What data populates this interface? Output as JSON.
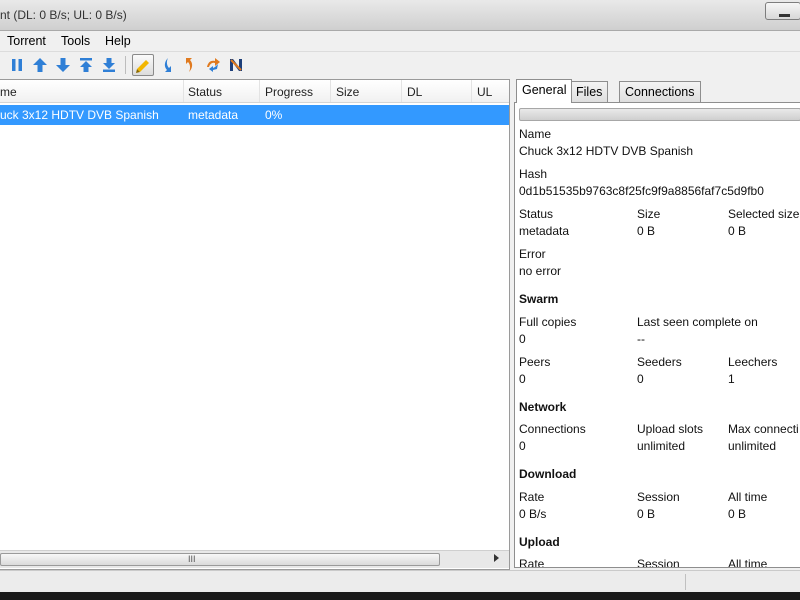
{
  "window": {
    "title": "nt (DL: 0 B/s; UL: 0 B/s)"
  },
  "menu": {
    "items": [
      "Torrent",
      "Tools",
      "Help"
    ]
  },
  "toolbar": {
    "icons": [
      "pause-icon",
      "move-up-icon",
      "move-down-icon",
      "move-top-icon",
      "move-bottom-icon",
      "filter-icon",
      "download-limit-icon",
      "upload-limit-icon",
      "transfer-icon",
      "network-icon"
    ],
    "accent_color": "#2f7fd6"
  },
  "list": {
    "columns": [
      "me",
      "Status",
      "Progress",
      "Size",
      "DL",
      "UL"
    ],
    "rows": [
      {
        "name": "uck 3x12 HDTV DVB Spanish",
        "status": "metadata",
        "progress": "0%",
        "size": "",
        "dl": "",
        "ul": ""
      }
    ],
    "scrollbar_grip": "III",
    "selection_color": "#3399ff"
  },
  "details": {
    "tabs": [
      "General",
      "Files",
      "Connections"
    ],
    "active_tab": "General",
    "name_label": "Name",
    "name_value": "Chuck 3x12 HDTV DVB Spanish",
    "hash_label": "Hash",
    "hash_value": "0d1b51535b9763c8f25fc9f9a8856faf7c5d9fb0",
    "status_label": "Status",
    "status_value": "metadata",
    "size_label": "Size",
    "size_value": "0 B",
    "selected_size_label": "Selected size",
    "selected_size_value": "0 B",
    "error_label": "Error",
    "error_value": "no error",
    "swarm_heading": "Swarm",
    "full_copies_label": "Full copies",
    "full_copies_value": "0",
    "last_seen_label": "Last seen complete on",
    "last_seen_value": "--",
    "peers_label": "Peers",
    "peers_value": "0",
    "seeders_label": "Seeders",
    "seeders_value": "0",
    "leechers_label": "Leechers",
    "leechers_value": "1",
    "network_heading": "Network",
    "connections_label": "Connections",
    "connections_value": "0",
    "upload_slots_label": "Upload slots",
    "upload_slots_value": "unlimited",
    "max_connections_label": "Max connecti",
    "max_connections_value": "unlimited",
    "download_heading": "Download",
    "dl_rate_label": "Rate",
    "dl_rate_value": "0 B/s",
    "dl_session_label": "Session",
    "dl_session_value": "0 B",
    "dl_alltime_label": "All time",
    "dl_alltime_value": "0 B",
    "upload_heading": "Upload",
    "ul_rate_label": "Rate",
    "ul_session_label": "Session",
    "ul_alltime_label": "All time"
  }
}
